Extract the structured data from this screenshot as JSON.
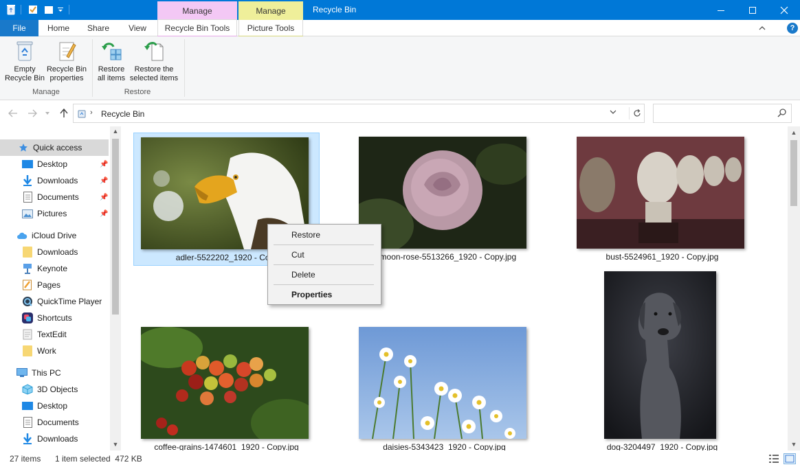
{
  "window": {
    "title": "Recycle Bin",
    "contextual_tabs": [
      {
        "header": "Manage",
        "tab": "Recycle Bin Tools",
        "color": "#f3c8f5"
      },
      {
        "header": "Manage",
        "tab": "Picture Tools",
        "color": "#efef9a"
      }
    ],
    "accent": "#0078d7"
  },
  "ribbon": {
    "file_label": "File",
    "tabs": [
      "Home",
      "Share",
      "View"
    ],
    "groups": [
      {
        "label": "Manage",
        "buttons": [
          {
            "label": "Empty\nRecycle Bin",
            "icon": "recycle-bin-icon"
          },
          {
            "label": "Recycle Bin\nproperties",
            "icon": "properties-icon"
          }
        ]
      },
      {
        "label": "Restore",
        "buttons": [
          {
            "label": "Restore\nall items",
            "icon": "restore-all-icon"
          },
          {
            "label": "Restore the\nselected items",
            "icon": "restore-selected-icon"
          }
        ]
      }
    ]
  },
  "address": {
    "location": "Recycle Bin",
    "search_placeholder": ""
  },
  "nav": {
    "quick_access": "Quick access",
    "quick_items": [
      "Desktop",
      "Downloads",
      "Documents",
      "Pictures"
    ],
    "icloud": "iCloud Drive",
    "icloud_items": [
      "Downloads",
      "Keynote",
      "Pages",
      "QuickTime Player",
      "Shortcuts",
      "TextEdit",
      "Work"
    ],
    "this_pc": "This PC",
    "pc_items": [
      "3D Objects",
      "Desktop",
      "Documents",
      "Downloads"
    ]
  },
  "files": [
    {
      "name": "adler-5522202_1920 - Copy.jpg",
      "shown": "adler-5522202_1920 - Copy",
      "selected": true
    },
    {
      "name": "the-moon-rose-5513266_1920 - Copy.jpg",
      "shown": "e-moon-rose-5513266_1920 - Copy.jpg",
      "selected": false
    },
    {
      "name": "bust-5524961_1920 - Copy.jpg",
      "shown": "bust-5524961_1920 - Copy.jpg",
      "selected": false
    },
    {
      "name": "coffee-grains-1474601_1920 - Copy.jpg",
      "shown": "coffee-grains-1474601_1920 - Copy.jpg",
      "selected": false
    },
    {
      "name": "daisies-5343423_1920 - Copy.jpg",
      "shown": "daisies-5343423_1920 - Copy.jpg",
      "selected": false
    },
    {
      "name": "dog-3204497_1920 - Copy.jpg",
      "shown": "dog-3204497_1920 - Copy.jpg",
      "selected": false
    }
  ],
  "context_menu": {
    "items": [
      "Restore",
      "Cut",
      "Delete",
      "Properties"
    ]
  },
  "status": {
    "count": "27 items",
    "selection": "1 item selected  472 KB"
  }
}
